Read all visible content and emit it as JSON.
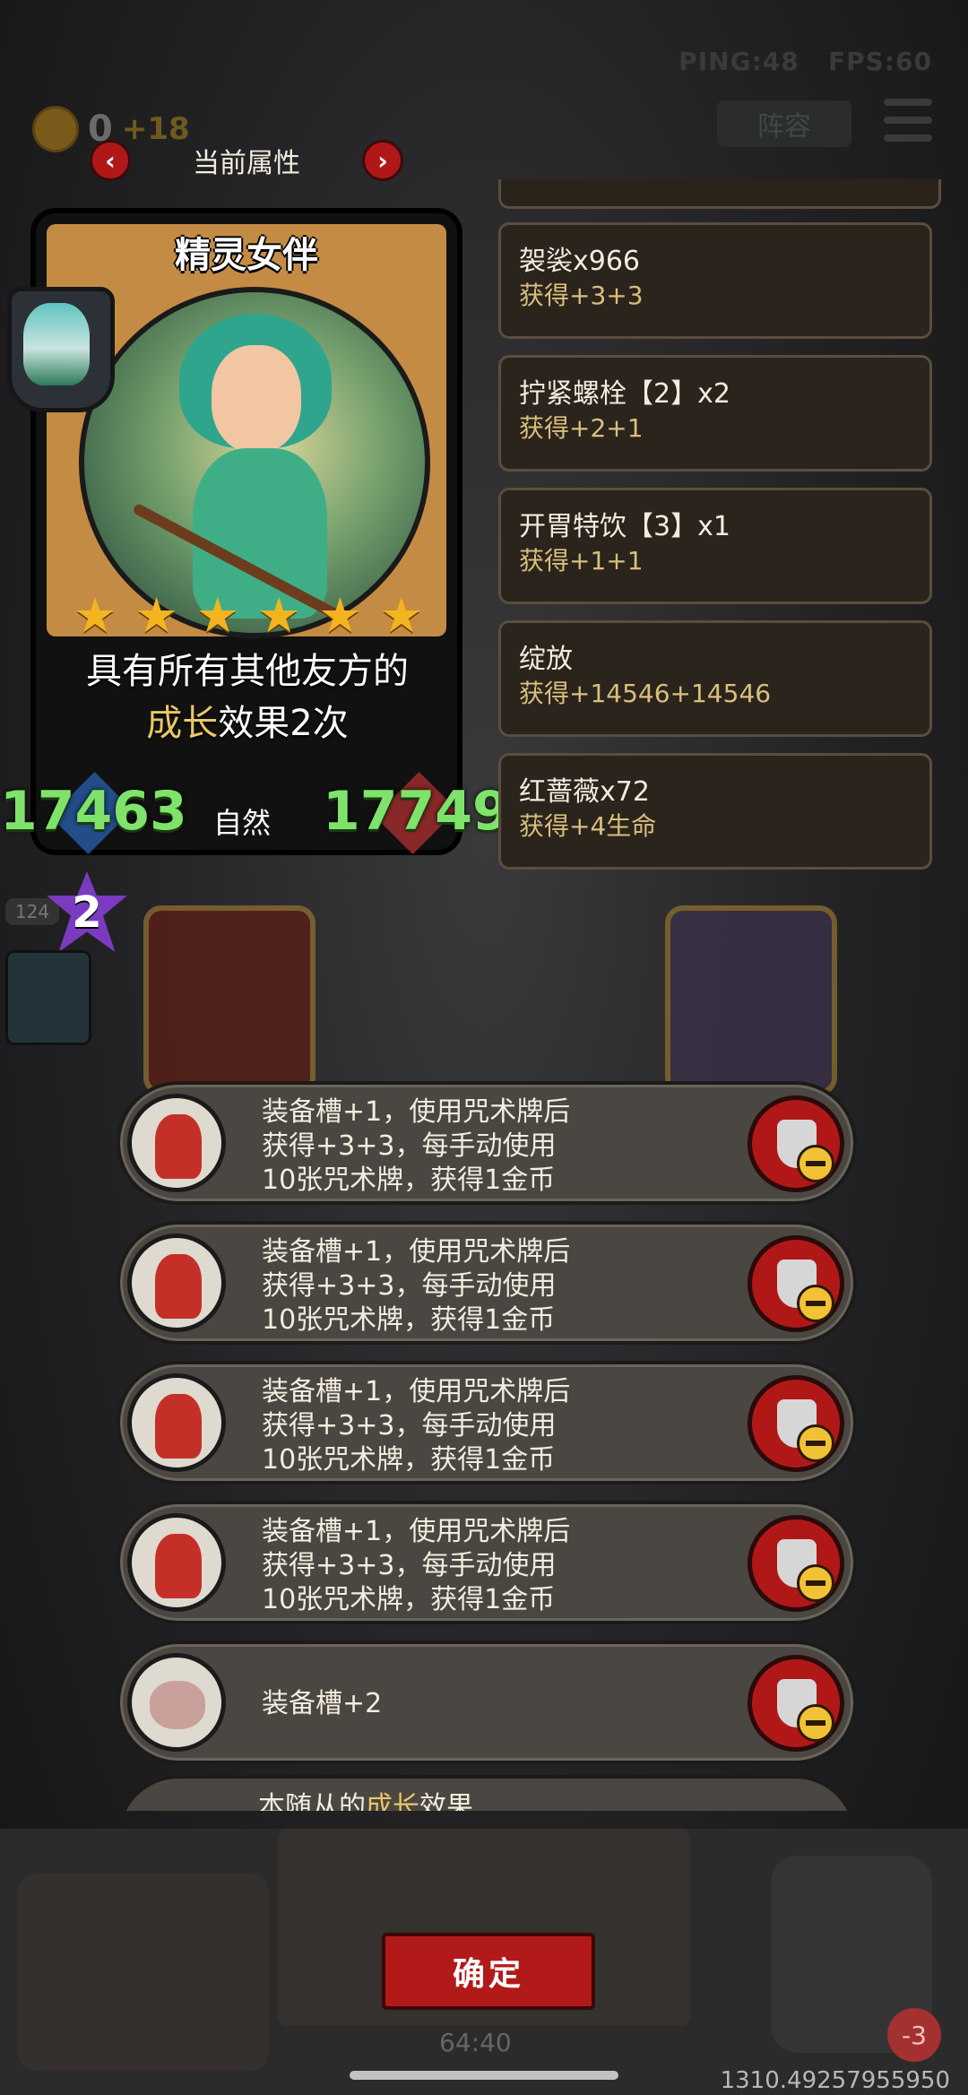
{
  "hud": {
    "ping": "PING:48",
    "fps": "FPS:60",
    "gold_value": "0",
    "gold_income": "+18",
    "team_label": "阵容"
  },
  "attr_header": {
    "title": "当前属性",
    "prev": "‹",
    "next": "›"
  },
  "card": {
    "name": "精灵女伴",
    "stars": 6,
    "desc_line1": "具有所有其他友方的",
    "desc_hl": "成长",
    "desc_rest": "效果2次",
    "attack": "17463",
    "race": "自然",
    "health": "17749"
  },
  "attributes": [
    {
      "title": "袈裟x966",
      "sub": "获得+3+3"
    },
    {
      "title": "拧紧螺栓【2】x2",
      "sub": "获得+2+1"
    },
    {
      "title": "开胃特饮【3】x1",
      "sub": "获得+1+1"
    },
    {
      "title": "绽放",
      "sub": "获得+14546+14546"
    },
    {
      "title": "红蔷薇x72",
      "sub": "获得+4生命"
    }
  ],
  "level": {
    "num": "2",
    "tag": "124"
  },
  "equipment": [
    {
      "icon": "cloak-icon",
      "lines": [
        "装备槽+1，使用咒术牌后",
        "获得+3+3，每手动使用",
        "10张咒术牌，获得1金币"
      ]
    },
    {
      "icon": "cloak-icon",
      "lines": [
        "装备槽+1，使用咒术牌后",
        "获得+3+3，每手动使用",
        "10张咒术牌，获得1金币"
      ]
    },
    {
      "icon": "cloak-icon",
      "lines": [
        "装备槽+1，使用咒术牌后",
        "获得+3+3，每手动使用",
        "10张咒术牌，获得1金币"
      ]
    },
    {
      "icon": "cloak-icon",
      "lines": [
        "装备槽+1，使用咒术牌后",
        "获得+3+3，每手动使用",
        "10张咒术牌，获得1金币"
      ]
    },
    {
      "icon": "pig-icon",
      "lines": [
        "装备槽+2"
      ]
    }
  ],
  "equipment_partial": {
    "prefix": "本随从的",
    "hl": "成长",
    "suffix": "效果"
  },
  "bottom": {
    "confirm": "确定",
    "timer": "64:40",
    "coords": "1310.49257955950",
    "hero_minus": "-3"
  },
  "colors": {
    "accent_red": "#b21a1a",
    "stat_green": "#7fe36b",
    "highlight_gold": "#e9c765",
    "star": "#f3b420"
  }
}
